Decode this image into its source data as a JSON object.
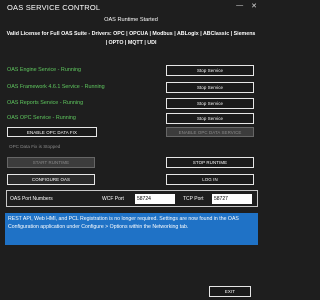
{
  "window": {
    "title": "OAS SERVICE CONTROL",
    "minimize_glyph": "—",
    "close_glyph": "✕"
  },
  "status": {
    "title": "OAS Runtime Started",
    "license": "Valid License for Full OAS Suite - Drivers: OPC | OPCUA | Modbus | ABLogix | ABClassic | Siemens | OPTO | MQTT | UDI"
  },
  "services": [
    {
      "label": "OAS Engine Service - Running",
      "button": "Stop Service"
    },
    {
      "label": "OAS Framework 4.6.1 Service - Running",
      "button": "Stop Service"
    },
    {
      "label": "OAS Reports Service - Running",
      "button": "Stop Service"
    },
    {
      "label": "OAS OPC Service - Running",
      "button": "Stop Service"
    }
  ],
  "opc": {
    "enable_fix": "ENABLE OPC DATA FIX",
    "enable_service": "ENABLE OPC DATA SERVICE",
    "status": "OPC Data Fix is Stopped"
  },
  "runtime": {
    "start": "START RUNTIME",
    "stop": "STOP RUNTIME",
    "configure": "CONFIGURE OAS",
    "login": "LOG IN"
  },
  "ports": {
    "label": "OAS Port Numbers",
    "wcf_label": "WCF Port",
    "wcf_value": "58724",
    "tcp_label": "TCP Port",
    "tcp_value": "58727"
  },
  "notice": {
    "text": "REST API, Web HMI, and PCL Registration is no longer required. Settings are now found in the OAS Configuration application under Configure > Options within the Networking tab."
  },
  "footer": {
    "exit": "EXIT"
  },
  "colors": {
    "running": "#5fc85f",
    "notice_bg": "#1f72c6",
    "window_bg": "#1e1e1e"
  }
}
